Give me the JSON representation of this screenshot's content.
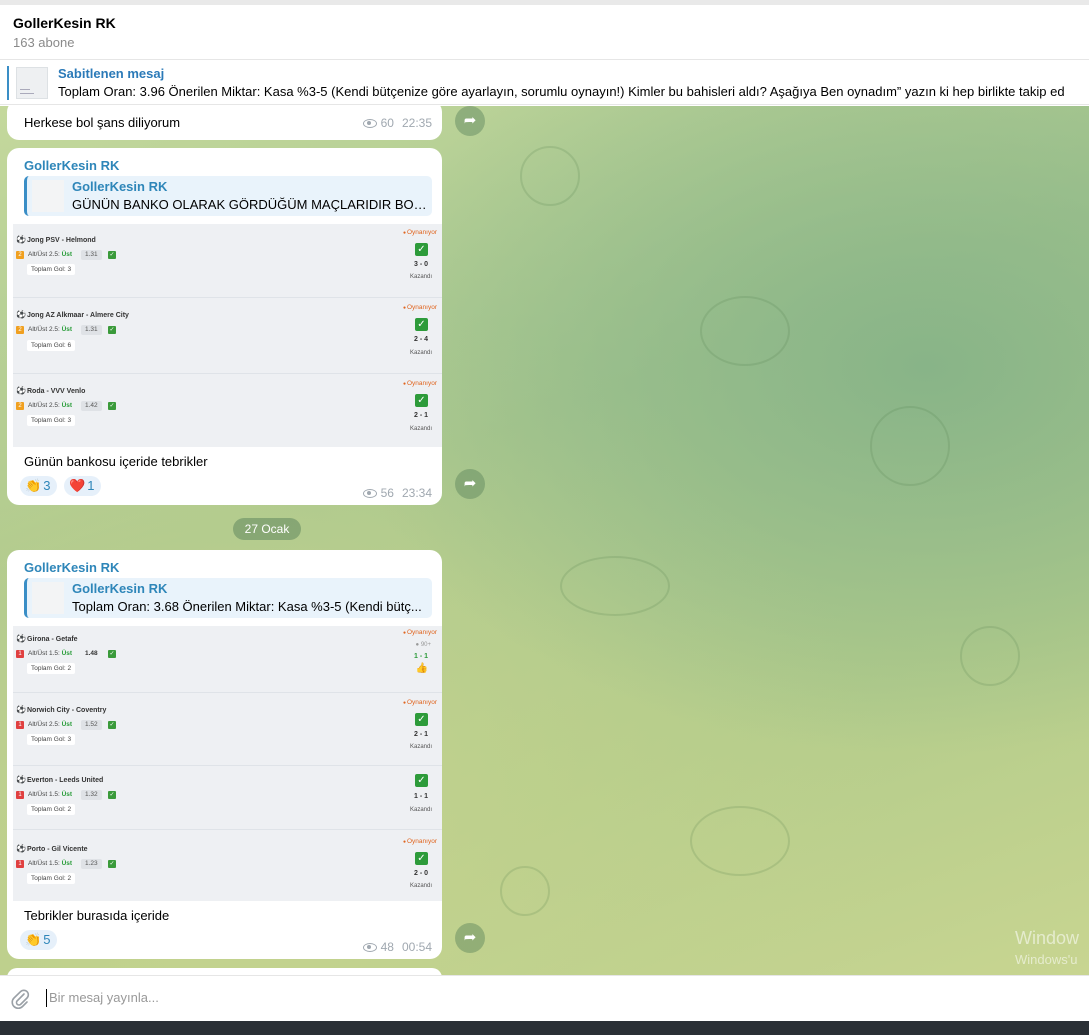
{
  "channel": {
    "title": "GollerKesin RK",
    "subscribers": "163 abone"
  },
  "pinned": {
    "label": "Sabitlenen mesaj",
    "text": "Toplam Oran: 3.96   Önerilen Miktar: Kasa %3-5 (Kendi bütçenize göre ayarlayın, sorumlu oynayın!)   Kimler bu bahisleri aldı?  Aşağıya Ben oynadım” yazın ki hep birlikte takip ed"
  },
  "messages": {
    "m0": {
      "caption": "Herkese bol şans diliyorum",
      "views": "60",
      "time": "22:35"
    },
    "m1": {
      "sender": "GollerKesin RK",
      "reply": {
        "name": "GollerKesin RK",
        "text": "GÜNÜN BANKO OLARAK GÖRDÜĞÜM MAÇLARIDIR BOL Ş..."
      },
      "matches": [
        {
          "name": "Jong PSV - Helmond",
          "market": "Alt/Üst 2.5:",
          "pick": "Üst",
          "odds": "1.31",
          "goals": "Toplam Gol: 3",
          "status": "Oynanıyor",
          "score": "3 - 0",
          "result": "Kazandı"
        },
        {
          "name": "Jong AZ Alkmaar - Almere City",
          "market": "Alt/Üst 2.5:",
          "pick": "Üst",
          "odds": "1.31",
          "goals": "Toplam Gol: 6",
          "status": "Oynanıyor",
          "score": "2 - 4",
          "result": "Kazandı"
        },
        {
          "name": "Roda - VVV Venlo",
          "market": "Alt/Üst 2.5:",
          "pick": "Üst",
          "odds": "1.42",
          "goals": "Toplam Gol: 3",
          "status": "Oynanıyor",
          "score": "2 - 1",
          "result": "Kazandı"
        }
      ],
      "caption": "Günün bankosu içeride tebrikler",
      "reactions": [
        {
          "emoji": "👏",
          "count": "3"
        },
        {
          "emoji": "❤️",
          "count": "1"
        }
      ],
      "views": "56",
      "time": "23:34"
    },
    "date_separator": "27 Ocak",
    "m2": {
      "sender": "GollerKesin RK",
      "reply": {
        "name": "GollerKesin RK",
        "text": "Toplam Oran: 3.68   Önerilen Miktar: Kasa %3-5 (Kendi bütç..."
      },
      "matches": [
        {
          "name": "Girona - Getafe",
          "market": "Alt/Üst 1.5:",
          "pick": "Üst",
          "odds": "1.48",
          "goals": "Toplam Gol: 2",
          "status": "Oynanıyor",
          "minute": "90+",
          "score": "1 - 1"
        },
        {
          "name": "Norwich City - Coventry",
          "market": "Alt/Üst 2.5:",
          "pick": "Üst",
          "odds": "1.52",
          "goals": "Toplam Gol: 3",
          "status": "Oynanıyor",
          "score": "2 - 1",
          "result": "Kazandı"
        },
        {
          "name": "Everton - Leeds United",
          "market": "Alt/Üst 1.5:",
          "pick": "Üst",
          "odds": "1.32",
          "goals": "Toplam Gol: 2",
          "score": "1 - 1",
          "result": "Kazandı"
        },
        {
          "name": "Porto - Gil Vicente",
          "market": "Alt/Üst 1.5:",
          "pick": "Üst",
          "odds": "1.23",
          "goals": "Toplam Gol: 2",
          "status": "Oynanıyor",
          "score": "2 - 0",
          "result": "Kazandı"
        }
      ],
      "caption": "Tebrikler burasıda içeride",
      "reactions": [
        {
          "emoji": "👏",
          "count": "5"
        }
      ],
      "views": "48",
      "time": "00:54"
    }
  },
  "watermark": {
    "line1": "Window",
    "line2": "Windows'u"
  },
  "composer": {
    "placeholder": "Bir mesaj yayınla..."
  },
  "colors": {
    "accent": "#2e86b9",
    "win": "#2d9b3a",
    "live": "#e0641e",
    "bubble": "#ffffff"
  }
}
